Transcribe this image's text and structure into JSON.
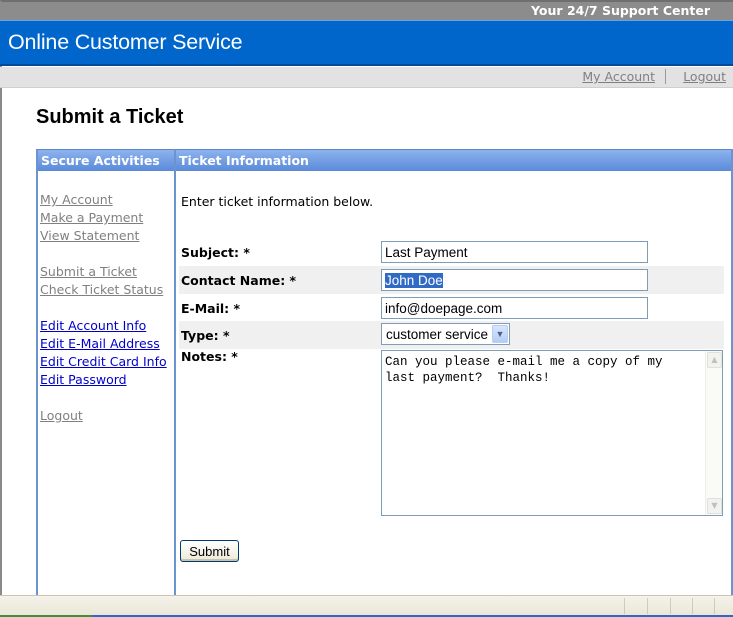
{
  "header": {
    "tagline": "Your 24/7 Support Center",
    "site_title": "Online Customer Service",
    "utility_links": {
      "my_account": "My Account",
      "logout": "Logout"
    }
  },
  "page": {
    "heading": "Submit a Ticket"
  },
  "sidebar": {
    "header": "Secure Activities",
    "groups": [
      [
        {
          "label": "My Account",
          "visited": true
        },
        {
          "label": "Make a Payment",
          "visited": true
        },
        {
          "label": "View Statement",
          "visited": true
        }
      ],
      [
        {
          "label": "Submit a Ticket",
          "visited": true
        },
        {
          "label": "Check Ticket Status",
          "visited": true
        }
      ],
      [
        {
          "label": "Edit Account Info",
          "visited": false
        },
        {
          "label": "Edit E-Mail Address",
          "visited": false
        },
        {
          "label": "Edit Credit Card Info",
          "visited": false
        },
        {
          "label": "Edit Password",
          "visited": false
        }
      ],
      [
        {
          "label": "Logout",
          "visited": true
        }
      ]
    ]
  },
  "main": {
    "header": "Ticket Information",
    "intro": "Enter ticket information below.",
    "form": {
      "subject": {
        "label": "Subject: *",
        "value": "Last Payment"
      },
      "contact_name": {
        "label": "Contact Name: *",
        "value": "John Doe",
        "selected": true
      },
      "email": {
        "label": "E-Mail: *",
        "value": "info@doepage.com"
      },
      "type": {
        "label": "Type: *",
        "value": "customer service"
      },
      "notes": {
        "label": "Notes: *",
        "value": "Can you please e-mail me a copy of my\nlast payment?  Thanks!"
      }
    },
    "submit_label": "Submit"
  },
  "icons": {
    "dropdown_arrow": "▼",
    "scroll_up": "▲",
    "scroll_down": "▼"
  },
  "colors": {
    "banner": "#0066cc",
    "panel_header": "#6b93cf",
    "link_unvisited": "#0000cc",
    "link_visited": "#808080",
    "selection": "#316ac5"
  }
}
